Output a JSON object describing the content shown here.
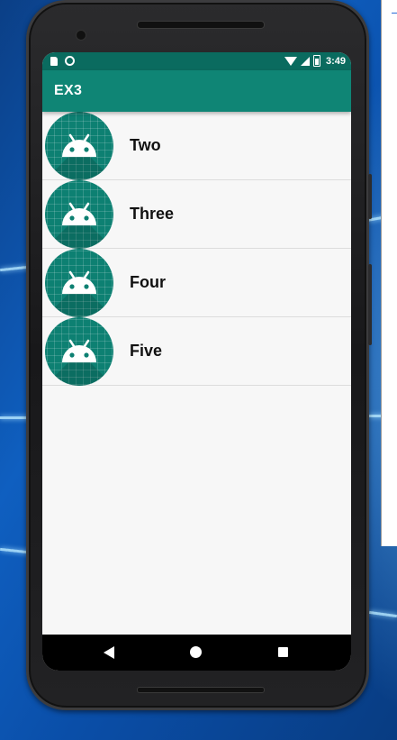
{
  "app": {
    "title": "EX3"
  },
  "status_bar": {
    "time": "3:49"
  },
  "list": {
    "items": [
      {
        "label": "Two",
        "icon": "android-icon"
      },
      {
        "label": "Three",
        "icon": "android-icon"
      },
      {
        "label": "Four",
        "icon": "android-icon"
      },
      {
        "label": "Five",
        "icon": "android-icon"
      }
    ]
  },
  "nav_bar": {
    "buttons": [
      "back-icon",
      "home-icon",
      "recents-icon"
    ]
  },
  "colors": {
    "status_bar": "#0a6b5f",
    "app_bar": "#0f8575",
    "avatar": "#0d8072",
    "screen_bg": "#f7f7f7"
  }
}
